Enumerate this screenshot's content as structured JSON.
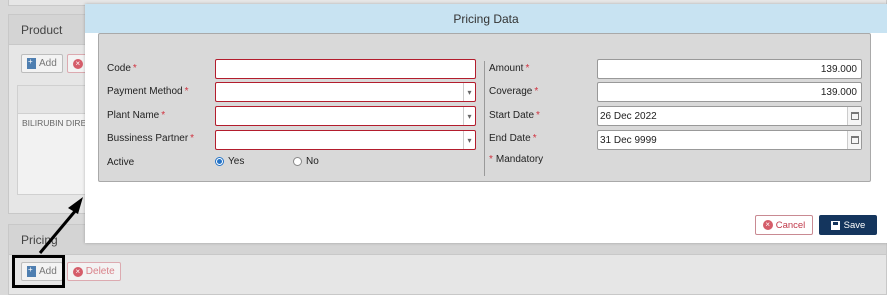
{
  "background": {
    "product_panel": {
      "title": "Product",
      "add_label": "Add",
      "delete_label": "D",
      "grid_cell": "BILIRUBIN DIRE"
    },
    "pricing_panel": {
      "title": "Pricing",
      "add_label": "Add",
      "delete_label": "Delete"
    }
  },
  "modal": {
    "title": "Pricing Data",
    "left_fields": {
      "code_label": "Code",
      "payment_method_label": "Payment Method",
      "plant_name_label": "Plant Name",
      "business_partner_label": "Bussiness Partner",
      "active_label": "Active",
      "active_yes": "Yes",
      "active_no": "No",
      "active_selected": "Yes"
    },
    "right_fields": {
      "amount_label": "Amount",
      "amount_value": "139.000",
      "coverage_label": "Coverage",
      "coverage_value": "139.000",
      "start_date_label": "Start Date",
      "start_date_value": "26 Dec 2022",
      "end_date_label": "End Date",
      "end_date_value": "31 Dec 9999",
      "mandatory_note": "Mandatory"
    },
    "required_marker": "*",
    "buttons": {
      "cancel_label": "Cancel",
      "save_label": "Save"
    }
  },
  "colors": {
    "modal_header": "#c8e3f2",
    "required": "#d0313e",
    "save_button": "#14355d",
    "cancel_text": "#c0394a"
  }
}
